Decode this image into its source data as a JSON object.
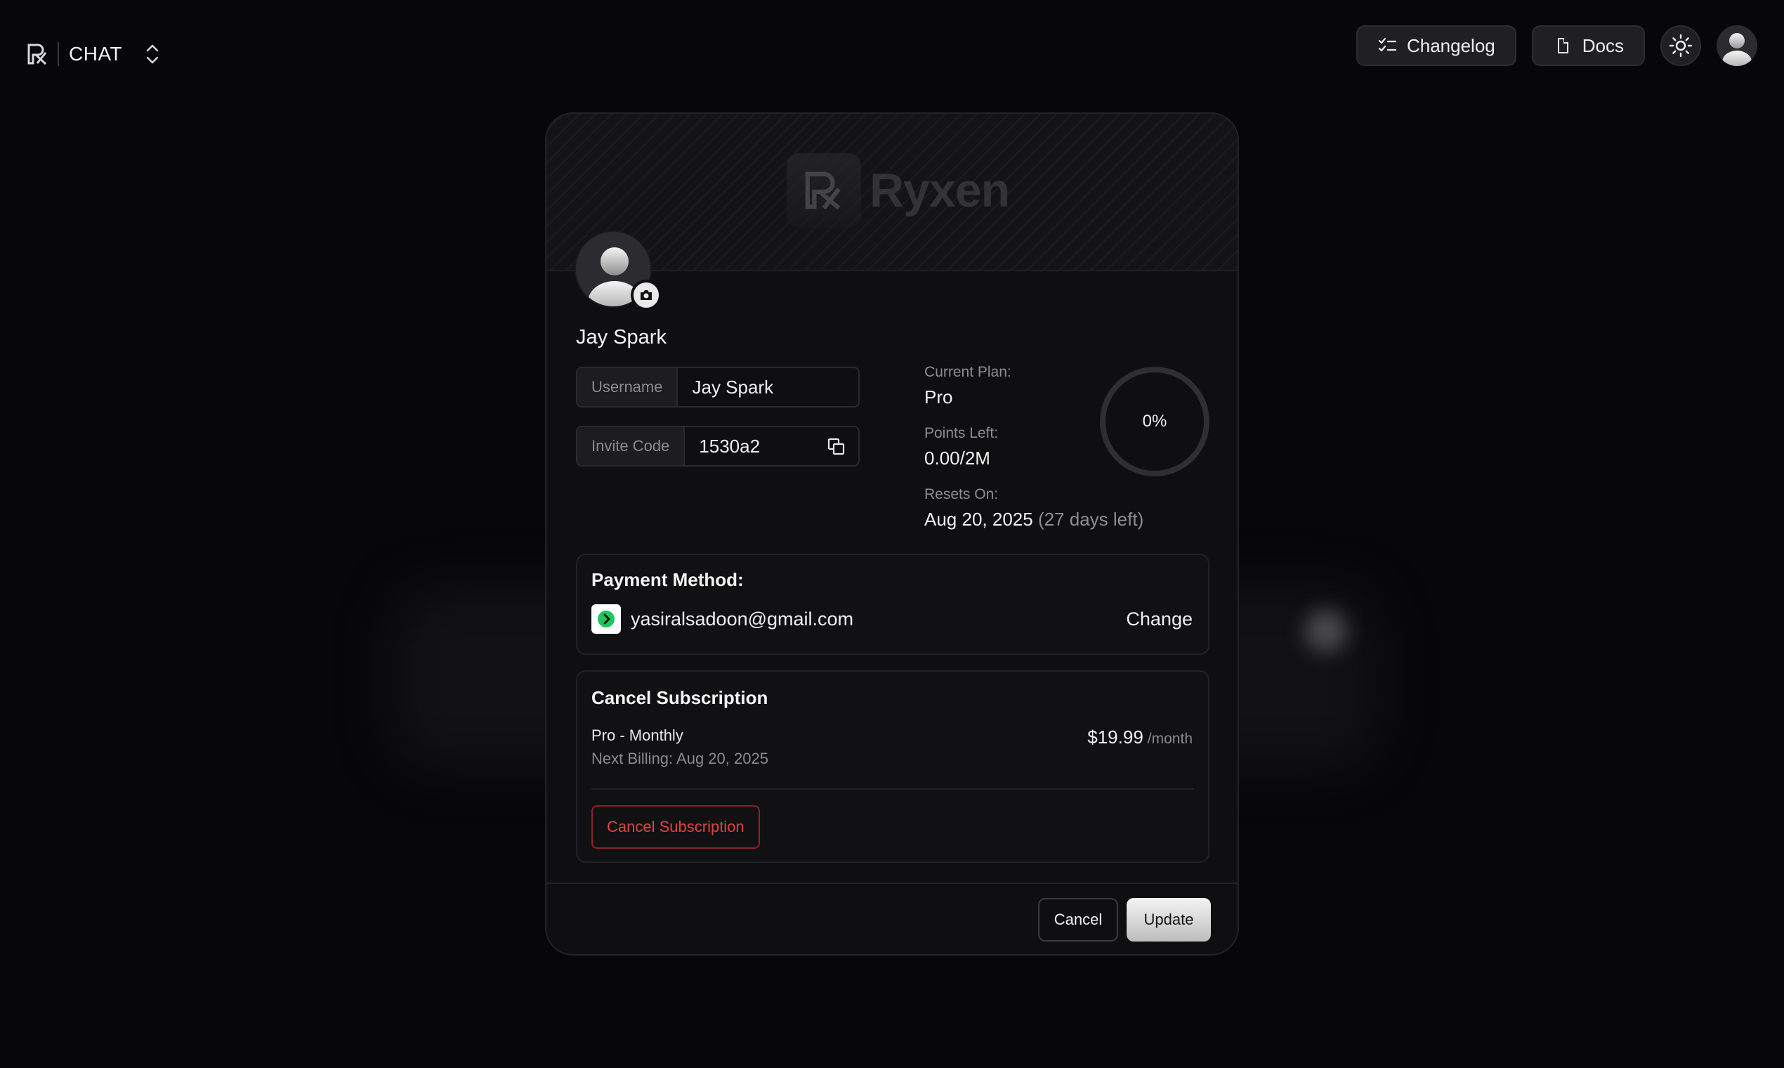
{
  "topbar": {
    "brand_name": "CHAT",
    "changelog_label": "Changelog",
    "docs_label": "Docs",
    "icons": {
      "brand": "rx-logo-icon",
      "switcher": "chevron-up-down-icon",
      "changelog": "list-checks-icon",
      "docs": "file-icon",
      "theme": "sun-icon",
      "account": "user-avatar-icon"
    }
  },
  "modal": {
    "banner_brand": "Ryxen",
    "display_name": "Jay Spark",
    "fields": {
      "username_label": "Username",
      "username_value": "Jay Spark",
      "invite_label": "Invite Code",
      "invite_value": "1530a2"
    },
    "usage": {
      "plan_label": "Current Plan:",
      "plan_value": "Pro",
      "points_label": "Points Left:",
      "points_value": "0.00/2M",
      "resets_label": "Resets On:",
      "resets_date": "Aug 20, 2025",
      "resets_remaining": "(27 days left)",
      "progress_text": "0%",
      "progress_fraction": 0
    },
    "payment": {
      "title": "Payment Method:",
      "email": "yasiralsadoon@gmail.com",
      "change_label": "Change"
    },
    "subscription": {
      "title": "Cancel Subscription",
      "plan": "Pro - Monthly",
      "next_billing": "Next Billing: Aug 20, 2025",
      "price": "$19.99",
      "period": "/month",
      "cancel_button": "Cancel Subscription"
    },
    "footer": {
      "cancel_label": "Cancel",
      "update_label": "Update"
    }
  },
  "colors": {
    "background": "#07070b",
    "modal": "#0f0f11",
    "danger": "#e2413f",
    "payment_accent": "#22c55e"
  }
}
